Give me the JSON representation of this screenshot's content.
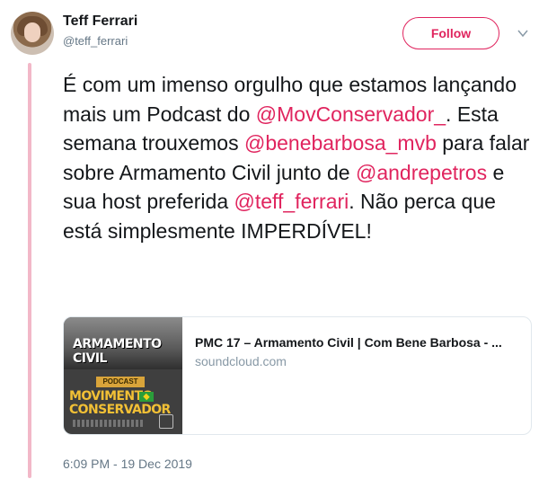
{
  "author": {
    "name": "Teff Ferrari",
    "handle": "@teff_ferrari"
  },
  "follow_button": {
    "label": "Follow"
  },
  "tweet": {
    "segments": [
      {
        "text": "É com um imenso orgulho que estamos lançando mais um Podcast do ",
        "type": "text"
      },
      {
        "text": "@MovConservador_",
        "type": "mention"
      },
      {
        "text": ". Esta semana trouxemos ",
        "type": "text"
      },
      {
        "text": "@benebarbosa_mvb",
        "type": "mention"
      },
      {
        "text": " para falar sobre Armamento Civil junto de ",
        "type": "text"
      },
      {
        "text": "@andrepetros",
        "type": "mention"
      },
      {
        "text": " e sua host preferida ",
        "type": "text"
      },
      {
        "text": "@teff_ferrari",
        "type": "mention"
      },
      {
        "text": ". Não perca que está simplesmente IMPERDÍVEL!",
        "type": "text"
      }
    ]
  },
  "link_card": {
    "title": "PMC 17 – Armamento Civil | Com Bene Barbosa - ...",
    "domain": "soundcloud.com",
    "image": {
      "header_text": "ARMAMENTO CIVIL",
      "tag_text": "PODCAST",
      "brand_line1": "MOVIMENTO",
      "brand_line2": "CONSERVADOR"
    }
  },
  "timestamp": "6:09 PM - 19 Dec 2019",
  "colors": {
    "accent": "#e0245e",
    "thread_line": "#f2b8c8",
    "secondary_text": "#657786"
  },
  "icons": {
    "caret": "chevron-down-icon"
  }
}
